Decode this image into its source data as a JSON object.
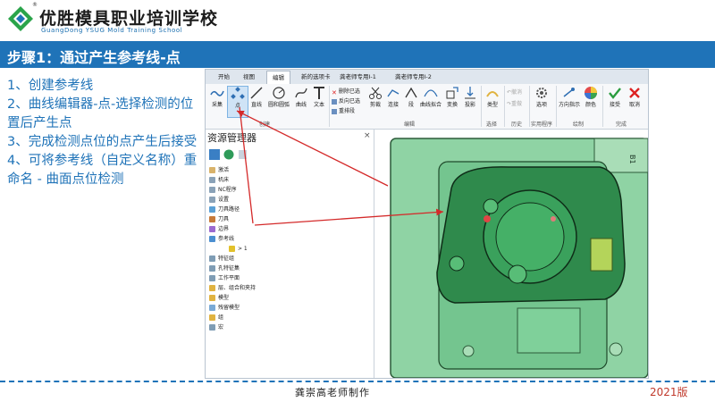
{
  "header": {
    "school_name": "优胜模具职业培训学校",
    "school_name_en": "GuangDong YSUG Mold Training School",
    "registered_mark": "®",
    "title": "步骤1：通过产生参考线-点"
  },
  "steps": [
    "1、创建参考线",
    "2、曲线编辑器-点-选择检测的位置后产生点",
    "3、完成检测点位的点产生后接受",
    "4、可将参考线（自定义名称）重命名 - 曲面点位检测"
  ],
  "app": {
    "tabs": [
      "开始",
      "视图",
      "编辑",
      "新的选项卡",
      "龚老师专用Ⅰ-1",
      "龚老师专用Ⅰ-2"
    ],
    "active_tab": "编辑",
    "ribbon": {
      "buttons": [
        "采集",
        "点",
        "直线",
        "圆和圆弧",
        "曲线",
        "文本"
      ],
      "small_cmds": [
        "删除已选",
        "反向已选",
        "重排段"
      ],
      "buttons2": [
        "剪裁",
        "连接",
        "段",
        "曲线拟合",
        "变换",
        "投影"
      ],
      "select": "类型",
      "history_undo": "撤消",
      "history_redo": "重做",
      "options": "选项",
      "direction": "方向指示",
      "color": "颜色",
      "accept": "接受",
      "cancel": "取消",
      "groups": [
        "创建",
        "编辑",
        "选择",
        "历史",
        "实用程序",
        "绘制",
        "完成"
      ]
    },
    "resource_manager": {
      "title": "资源管理器",
      "close": "×",
      "tree": [
        {
          "label": "激活",
          "color": "#d9b36b"
        },
        {
          "label": "机床",
          "color": "#8aa2b8"
        },
        {
          "label": "NC程序",
          "color": "#8aa2b8"
        },
        {
          "label": "设置",
          "color": "#8aa2b8"
        },
        {
          "label": "刀具路径",
          "color": "#5aa0d6"
        },
        {
          "label": "刀具",
          "color": "#c77a3a"
        },
        {
          "label": "边界",
          "color": "#9c6ad0"
        },
        {
          "label": "参考线",
          "color": "#4b8fd1"
        },
        {
          "label": "> 1",
          "color": "#e2c12b"
        },
        {
          "label": "特征组",
          "color": "#7f9db5"
        },
        {
          "label": "孔特征集",
          "color": "#7f9db5"
        },
        {
          "label": "工作平面",
          "color": "#7f9db5"
        },
        {
          "label": "层、组合和夹持",
          "color": "#e0b341"
        },
        {
          "label": "模型",
          "color": "#e0b341"
        },
        {
          "label": "残留模型",
          "color": "#7aaad6"
        },
        {
          "label": "组",
          "color": "#e0b341"
        },
        {
          "label": "宏",
          "color": "#7f9db5"
        }
      ]
    },
    "viewport": {
      "label": "B1"
    }
  },
  "footer": {
    "author": "龚崇高老师制作",
    "year": "2021版"
  }
}
